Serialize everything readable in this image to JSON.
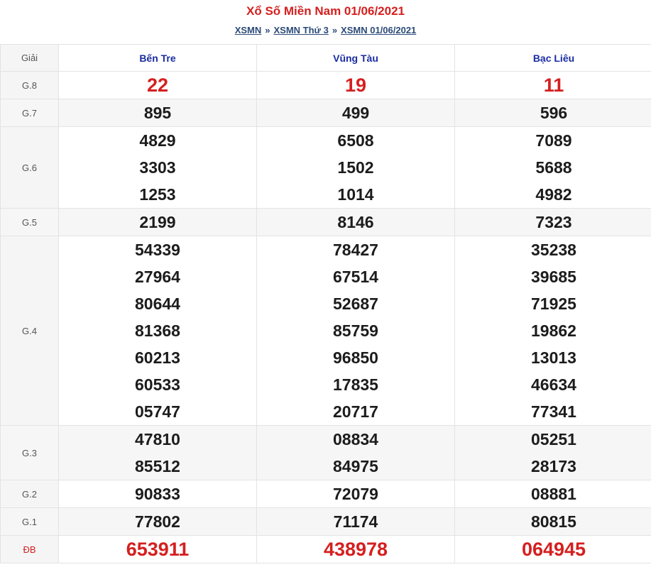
{
  "header": {
    "title": "Xổ Số Miền Nam 01/06/2021",
    "crumbs": [
      "XSMN",
      "XSMN Thứ 3",
      "XSMN 01/06/2021"
    ],
    "separator": "»"
  },
  "table": {
    "col_header": "Giải",
    "provinces": [
      "Bến Tre",
      "Vũng Tàu",
      "Bạc Liêu"
    ],
    "rows": [
      {
        "label": "G.8",
        "values": [
          [
            "22"
          ],
          [
            "19"
          ],
          [
            "11"
          ]
        ]
      },
      {
        "label": "G.7",
        "values": [
          [
            "895"
          ],
          [
            "499"
          ],
          [
            "596"
          ]
        ]
      },
      {
        "label": "G.6",
        "values": [
          [
            "4829",
            "3303",
            "1253"
          ],
          [
            "6508",
            "1502",
            "1014"
          ],
          [
            "7089",
            "5688",
            "4982"
          ]
        ]
      },
      {
        "label": "G.5",
        "values": [
          [
            "2199"
          ],
          [
            "8146"
          ],
          [
            "7323"
          ]
        ]
      },
      {
        "label": "G.4",
        "values": [
          [
            "54339",
            "27964",
            "80644",
            "81368",
            "60213",
            "60533",
            "05747"
          ],
          [
            "78427",
            "67514",
            "52687",
            "85759",
            "96850",
            "17835",
            "20717"
          ],
          [
            "35238",
            "39685",
            "71925",
            "19862",
            "13013",
            "46634",
            "77341"
          ]
        ]
      },
      {
        "label": "G.3",
        "values": [
          [
            "47810",
            "85512"
          ],
          [
            "08834",
            "84975"
          ],
          [
            "05251",
            "28173"
          ]
        ]
      },
      {
        "label": "G.2",
        "values": [
          [
            "90833"
          ],
          [
            "72079"
          ],
          [
            "08881"
          ]
        ]
      },
      {
        "label": "G.1",
        "values": [
          [
            "77802"
          ],
          [
            "71174"
          ],
          [
            "80815"
          ]
        ]
      },
      {
        "label": "ĐB",
        "values": [
          [
            "653911"
          ],
          [
            "438978"
          ],
          [
            "064945"
          ]
        ]
      }
    ]
  },
  "colors": {
    "accent_red": "#d51f1f",
    "header_blue": "#1a2ca3",
    "link": "#2b4a77"
  }
}
